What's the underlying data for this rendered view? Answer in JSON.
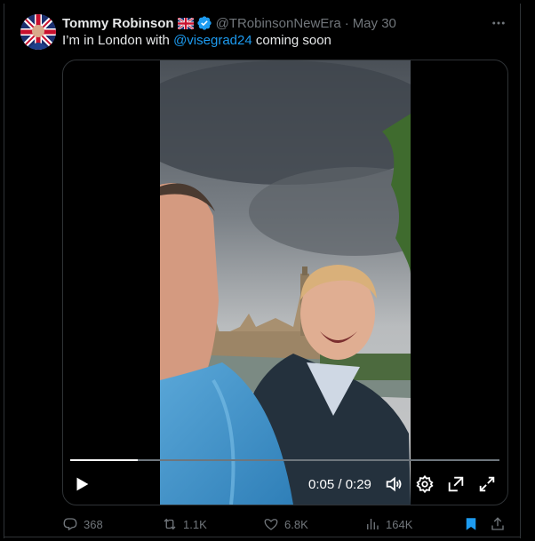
{
  "tweet": {
    "display_name": "Tommy Robinson",
    "handle": "@TRobinsonNewEra",
    "separator": "·",
    "date": "May 30",
    "text_before": "I’m in London with ",
    "mention": "@visegrad24",
    "text_after": " coming soon"
  },
  "video": {
    "current_time": "0:05",
    "duration": "0:29",
    "time_display": "0:05 / 0:29",
    "progress_fraction": 0.158
  },
  "actions": {
    "replies": "368",
    "retweets": "1.1K",
    "likes": "6.8K",
    "views": "164K"
  },
  "colors": {
    "background": "#000000",
    "text": "#e7e9ea",
    "muted": "#71767b",
    "accent": "#1d9bf0",
    "border": "#2f3336"
  },
  "icons": [
    "more-icon",
    "uk-flag-icon",
    "verified-badge-icon",
    "play-icon",
    "volume-icon",
    "settings-gear-icon",
    "popout-icon",
    "fullscreen-icon",
    "reply-icon",
    "retweet-icon",
    "like-icon",
    "views-icon",
    "bookmark-icon",
    "share-icon"
  ]
}
